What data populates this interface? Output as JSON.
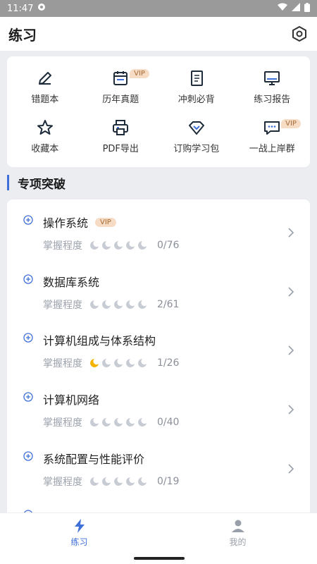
{
  "status_bar": {
    "time": "11:47"
  },
  "header": {
    "title": "练习"
  },
  "grid": {
    "items": [
      {
        "label": "错题本",
        "icon": "pencil-icon",
        "vip": ""
      },
      {
        "label": "历年真题",
        "icon": "calendar-icon",
        "vip": "VIP"
      },
      {
        "label": "冲刺必背",
        "icon": "notebook-icon",
        "vip": ""
      },
      {
        "label": "练习报告",
        "icon": "monitor-icon",
        "vip": ""
      },
      {
        "label": "收藏本",
        "icon": "star-icon",
        "vip": ""
      },
      {
        "label": "PDF导出",
        "icon": "printer-icon",
        "vip": ""
      },
      {
        "label": "订购学习包",
        "icon": "diamond-icon",
        "vip": ""
      },
      {
        "label": "一战上岸群",
        "icon": "chat-icon",
        "vip": "VIP"
      }
    ]
  },
  "section": {
    "title": "专项突破"
  },
  "topics": [
    {
      "title": "操作系统",
      "vip": "VIP",
      "mastery_label": "掌握程度",
      "mastery_level": 0,
      "progress": "0/76"
    },
    {
      "title": "数据库系统",
      "vip": "",
      "mastery_label": "掌握程度",
      "mastery_level": 0,
      "progress": "2/61"
    },
    {
      "title": "计算机组成与体系结构",
      "vip": "",
      "mastery_label": "掌握程度",
      "mastery_level": 1,
      "progress": "1/26"
    },
    {
      "title": "计算机网络",
      "vip": "",
      "mastery_label": "掌握程度",
      "mastery_level": 0,
      "progress": "0/40"
    },
    {
      "title": "系统配置与性能评价",
      "vip": "",
      "mastery_label": "掌握程度",
      "mastery_level": 0,
      "progress": "0/19"
    }
  ],
  "bottom_nav": [
    {
      "label": "练习",
      "icon": "lightning-icon",
      "active": true
    },
    {
      "label": "我的",
      "icon": "user-icon",
      "active": false
    }
  ],
  "colors": {
    "accent": "#3f6fd8",
    "vip_bg": "#f6dcc4",
    "vip_text": "#a66a33",
    "moon_active": "#f5b301",
    "moon_inactive": "#c7cbd3"
  }
}
